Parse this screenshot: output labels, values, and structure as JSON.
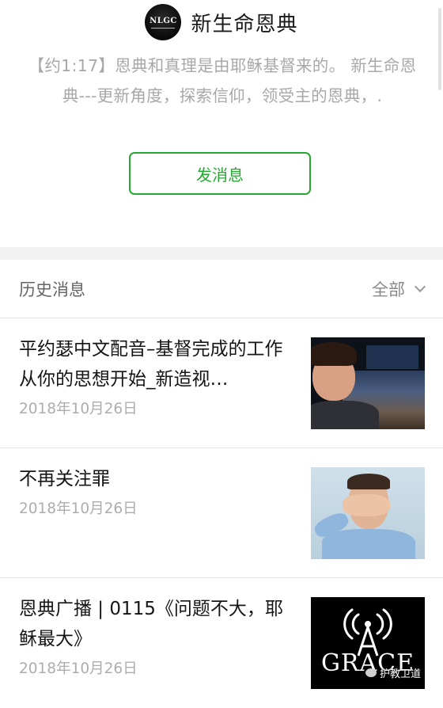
{
  "account": {
    "avatar_text": "NLGC",
    "name": "新生命恩典",
    "description": "【约1:17】恩典和真理是由耶稣基督来的。 新生命恩典---更新角度，探索信仰，领受主的恩典，.",
    "send_button_label": "发消息"
  },
  "history": {
    "title": "历史消息",
    "filter_label": "全部",
    "articles": [
      {
        "title": "平约瑟中文配音–基督完成的工作从你的思想开始_新造视…",
        "date": "2018年10月26日"
      },
      {
        "title": "不再关注罪",
        "date": "2018年10月26日"
      },
      {
        "title": "恩典广播 | 0115《问题不大，耶稣最大》",
        "date": "2018年10月26日"
      }
    ],
    "grace_logo_text": "GRACE"
  },
  "watermark": {
    "text": "护教卫道"
  },
  "colors": {
    "accent": "#27a832",
    "secondary_text": "#a8a8a8",
    "date_text": "#adadad",
    "divider": "#e6e6e6"
  }
}
